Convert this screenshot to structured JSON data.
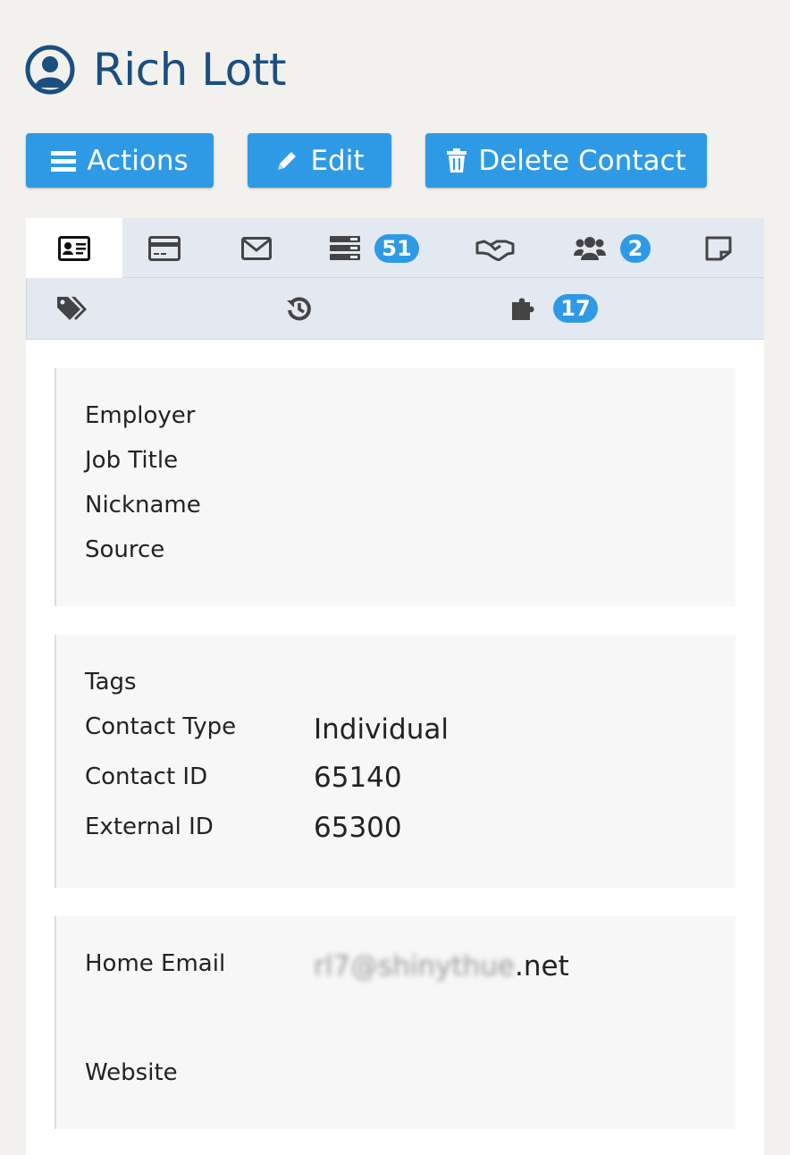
{
  "contact": {
    "name": "Rich Lott"
  },
  "toolbar": {
    "actions_label": "Actions",
    "edit_label": "Edit",
    "delete_label": "Delete Contact"
  },
  "tabs": {
    "activities_count": "51",
    "relationships_count": "2",
    "custom_count": "17"
  },
  "summary": {
    "employer_label": "Employer",
    "job_title_label": "Job Title",
    "nickname_label": "Nickname",
    "source_label": "Source"
  },
  "details": {
    "tags_label": "Tags",
    "contact_type_label": "Contact Type",
    "contact_type_value": "Individual",
    "contact_id_label": "Contact ID",
    "contact_id_value": "65140",
    "external_id_label": "External ID",
    "external_id_value": "65300"
  },
  "communication": {
    "home_email_label": "Home Email",
    "home_email_blurred": "rl7@shinythue",
    "home_email_suffix": ".net",
    "website_label": "Website"
  },
  "colors": {
    "accent": "#2e9ae6",
    "title": "#1a4f80",
    "icon": "#444444"
  }
}
